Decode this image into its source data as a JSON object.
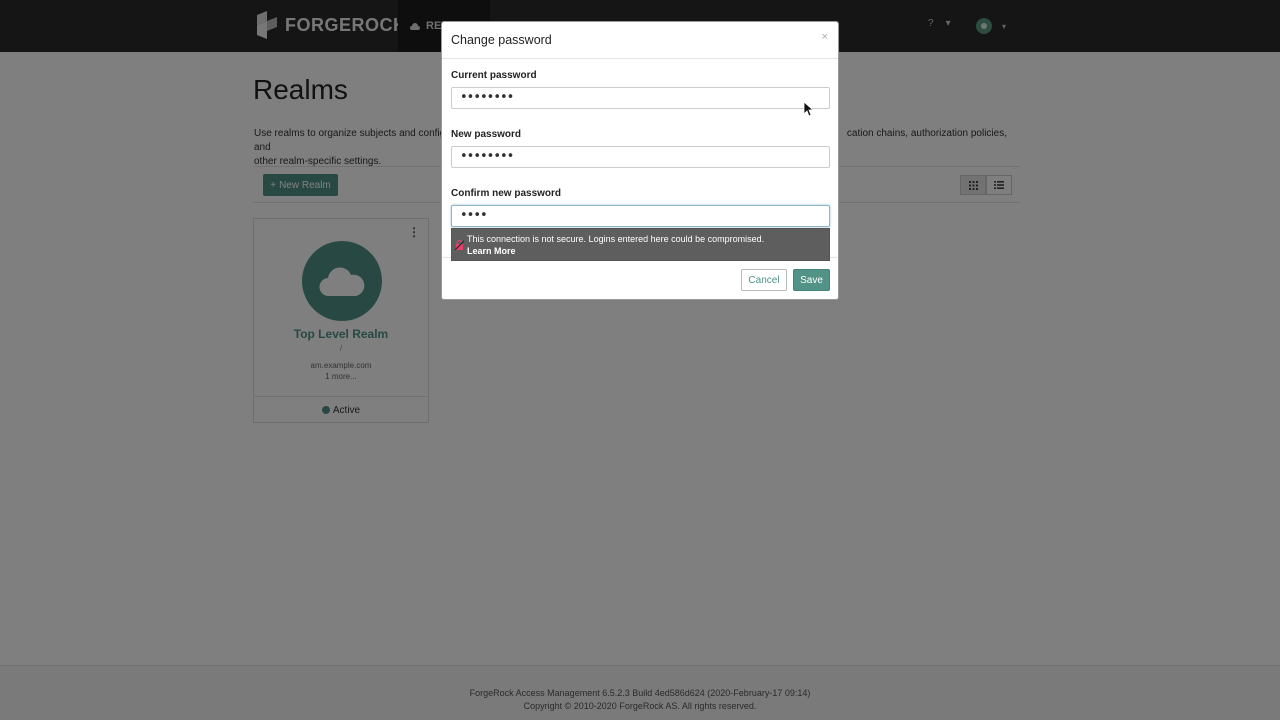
{
  "navbar": {
    "brand_text": "FORGEROCK",
    "tab_label": "RE",
    "help_icon": "question-icon",
    "user_icon": "user-icon"
  },
  "page": {
    "title": "Realms",
    "description_left": "Use realms to organize subjects and configur",
    "description_right": "cation chains, authorization policies, and",
    "description_line2": "other realm-specific settings.",
    "new_realm_label": "New Realm",
    "view_icons": [
      "grid-icon",
      "list-icon"
    ]
  },
  "realm_card": {
    "name": "Top Level Realm",
    "path": "/",
    "host": "am.example.com",
    "more": "1 more...",
    "status": "Active"
  },
  "footer": {
    "line1": "ForgeRock Access Management 6.5.2.3 Build 4ed586d624 (2020-February-17 09:14)",
    "line2": "Copyright © 2010-2020 ForgeRock AS. All rights reserved."
  },
  "modal": {
    "title": "Change password",
    "close_glyph": "×",
    "current_label": "Current password",
    "current_value": "••••••••",
    "new_label": "New password",
    "new_value": "••••••••",
    "confirm_label": "Confirm new password",
    "confirm_value": "••••",
    "warning_text": "This connection is not secure. Logins entered here could be compromised.",
    "warning_link": "Learn More",
    "cancel_label": "Cancel",
    "save_label": "Save"
  },
  "colors": {
    "accent": "#519387",
    "navbar": "#2b2b2b"
  }
}
